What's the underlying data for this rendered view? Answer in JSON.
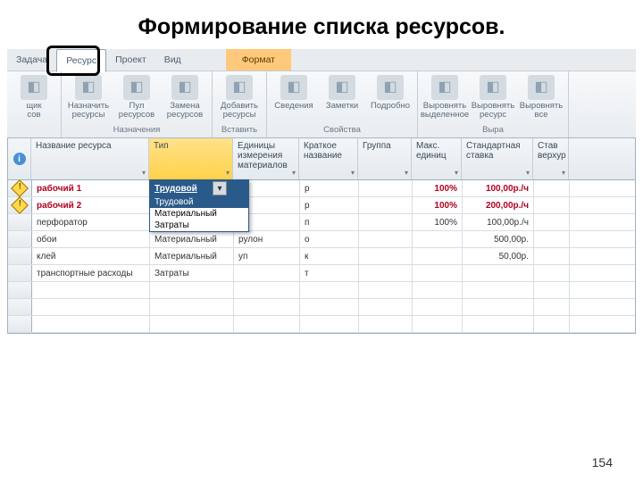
{
  "slide": {
    "title": "Формирование списка ресурсов.",
    "page_number": "154"
  },
  "tabs": {
    "items": [
      "Задача",
      "Ресурс",
      "Проект",
      "Вид"
    ],
    "format": "Формат",
    "active_index": 1
  },
  "ribbon": {
    "groups": [
      {
        "label": "",
        "buttons": [
          {
            "label": "щик\nсов"
          }
        ]
      },
      {
        "label": "Назначения",
        "buttons": [
          {
            "label": "Назначить\nресурсы"
          },
          {
            "label": "Пул\nресурсов"
          },
          {
            "label": "Замена\nресурсов"
          }
        ]
      },
      {
        "label": "Вставить",
        "buttons": [
          {
            "label": "Добавить\nресурсы"
          }
        ]
      },
      {
        "label": "Свойства",
        "buttons": [
          {
            "label": "Сведения"
          },
          {
            "label": "Заметки"
          },
          {
            "label": "Подробно"
          }
        ]
      },
      {
        "label": "Выра",
        "buttons": [
          {
            "label": "Выровнять\nвыделенное"
          },
          {
            "label": "Выровнять\nресурс"
          },
          {
            "label": "Выровнять\nвсе"
          }
        ]
      }
    ]
  },
  "grid": {
    "columns": [
      {
        "key": "info",
        "label": ""
      },
      {
        "key": "name",
        "label": "Название ресурса"
      },
      {
        "key": "type",
        "label": "Тип",
        "selected": true
      },
      {
        "key": "unit",
        "label": "Единицы\nизмерения\nматериалов"
      },
      {
        "key": "short",
        "label": "Краткое\nназвание"
      },
      {
        "key": "group",
        "label": "Группа"
      },
      {
        "key": "max",
        "label": "Макс.\nединиц"
      },
      {
        "key": "rate",
        "label": "Стандартная\nставка"
      },
      {
        "key": "over",
        "label": "Став\nверхур"
      }
    ],
    "rows": [
      {
        "warn": true,
        "red": true,
        "name": "рабочий 1",
        "type": "Трудовой",
        "unit": "",
        "short": "р",
        "group": "",
        "max": "100%",
        "rate": "100,00р./ч"
      },
      {
        "warn": true,
        "red": true,
        "name": "рабочий 2",
        "type": "Трудовой",
        "unit": "",
        "short": "р",
        "group": "",
        "max": "100%",
        "rate": "200,00р./ч"
      },
      {
        "warn": false,
        "red": false,
        "name": "перфоратор",
        "type": "",
        "unit": "",
        "short": "п",
        "group": "",
        "max": "100%",
        "rate": "100,00р./ч"
      },
      {
        "warn": false,
        "red": false,
        "name": "обои",
        "type": "Материальный",
        "unit": "рулон",
        "short": "о",
        "group": "",
        "max": "",
        "rate": "500,00р."
      },
      {
        "warn": false,
        "red": false,
        "name": "клей",
        "type": "Материальный",
        "unit": "уп",
        "short": "к",
        "group": "",
        "max": "",
        "rate": "50,00р."
      },
      {
        "warn": false,
        "red": false,
        "name": "транспортные расходы",
        "type": "Затраты",
        "unit": "",
        "short": "т",
        "group": "",
        "max": "",
        "rate": ""
      }
    ],
    "empty_rows": 3
  },
  "dropdown": {
    "selected": "Трудовой",
    "options": [
      "Трудовой",
      "Материальный",
      "Затраты"
    ]
  }
}
